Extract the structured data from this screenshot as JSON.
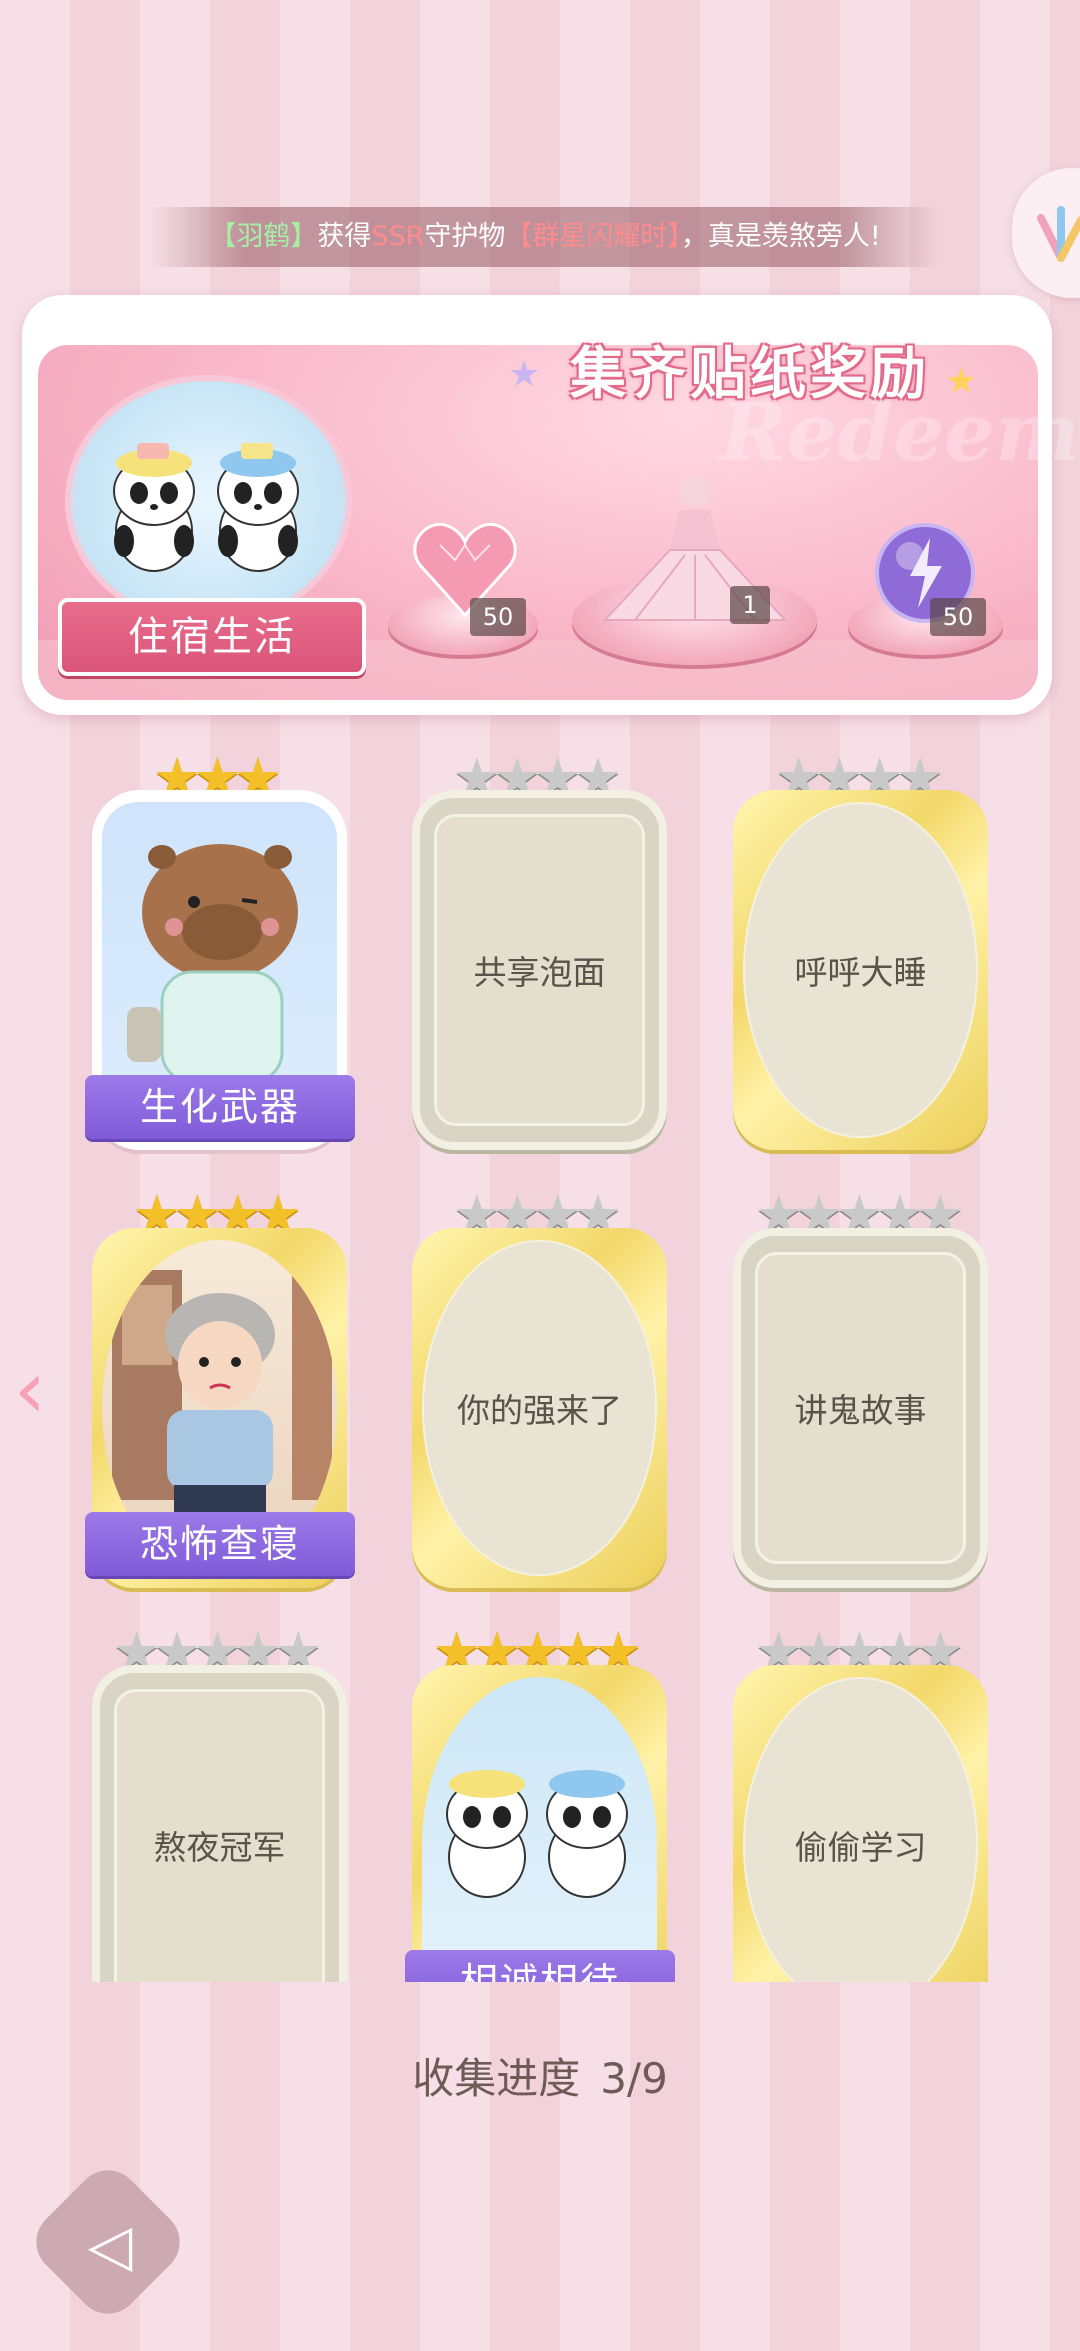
{
  "announcement": {
    "bracket_open": "【",
    "player": "羽鹤",
    "bracket_close": "】",
    "text1": "获得",
    "rarity": "SSR",
    "text2": "守护物",
    "item": "【群星闪耀时】",
    "text3": "，真是羡煞旁人!"
  },
  "reward": {
    "title": "集齐贴纸奖励",
    "watermark": "Redeem",
    "theme_name": "住宿生活",
    "items": [
      {
        "icon": "pink-heart-gem-icon",
        "count": "50"
      },
      {
        "icon": "dress-outfit-icon",
        "count": "1"
      },
      {
        "icon": "purple-energy-orb-icon",
        "count": "50"
      }
    ]
  },
  "cards": [
    {
      "name": "生化武器",
      "stars": 3,
      "star_color": "gold",
      "state": "unlocked",
      "art": "capybara-pajamas-icon"
    },
    {
      "name": "共享泡面",
      "stars": 4,
      "star_color": "silver",
      "state": "locked-frame"
    },
    {
      "name": "呼呼大睡",
      "stars": 4,
      "star_color": "silver",
      "state": "locked-oval"
    },
    {
      "name": "恐怖查寝",
      "stars": 4,
      "star_color": "gold",
      "state": "unlocked",
      "art": "dorm-auntie-icon"
    },
    {
      "name": "你的强来了",
      "stars": 4,
      "star_color": "silver",
      "state": "locked-oval"
    },
    {
      "name": "讲鬼故事",
      "stars": 5,
      "star_color": "silver",
      "state": "locked-frame"
    },
    {
      "name": "熬夜冠军",
      "stars": 5,
      "star_color": "silver",
      "state": "locked-frame"
    },
    {
      "name": "相诚相待",
      "stars": 5,
      "star_color": "gold",
      "state": "unlocked",
      "art": "two-pandas-bath-icon"
    },
    {
      "name": "偷偷学习",
      "stars": 5,
      "star_color": "silver",
      "state": "locked-oval"
    }
  ],
  "progress": {
    "label": "收集进度",
    "value": "3/9"
  },
  "nav": {
    "left_arrow": "‹",
    "back": "◁"
  }
}
